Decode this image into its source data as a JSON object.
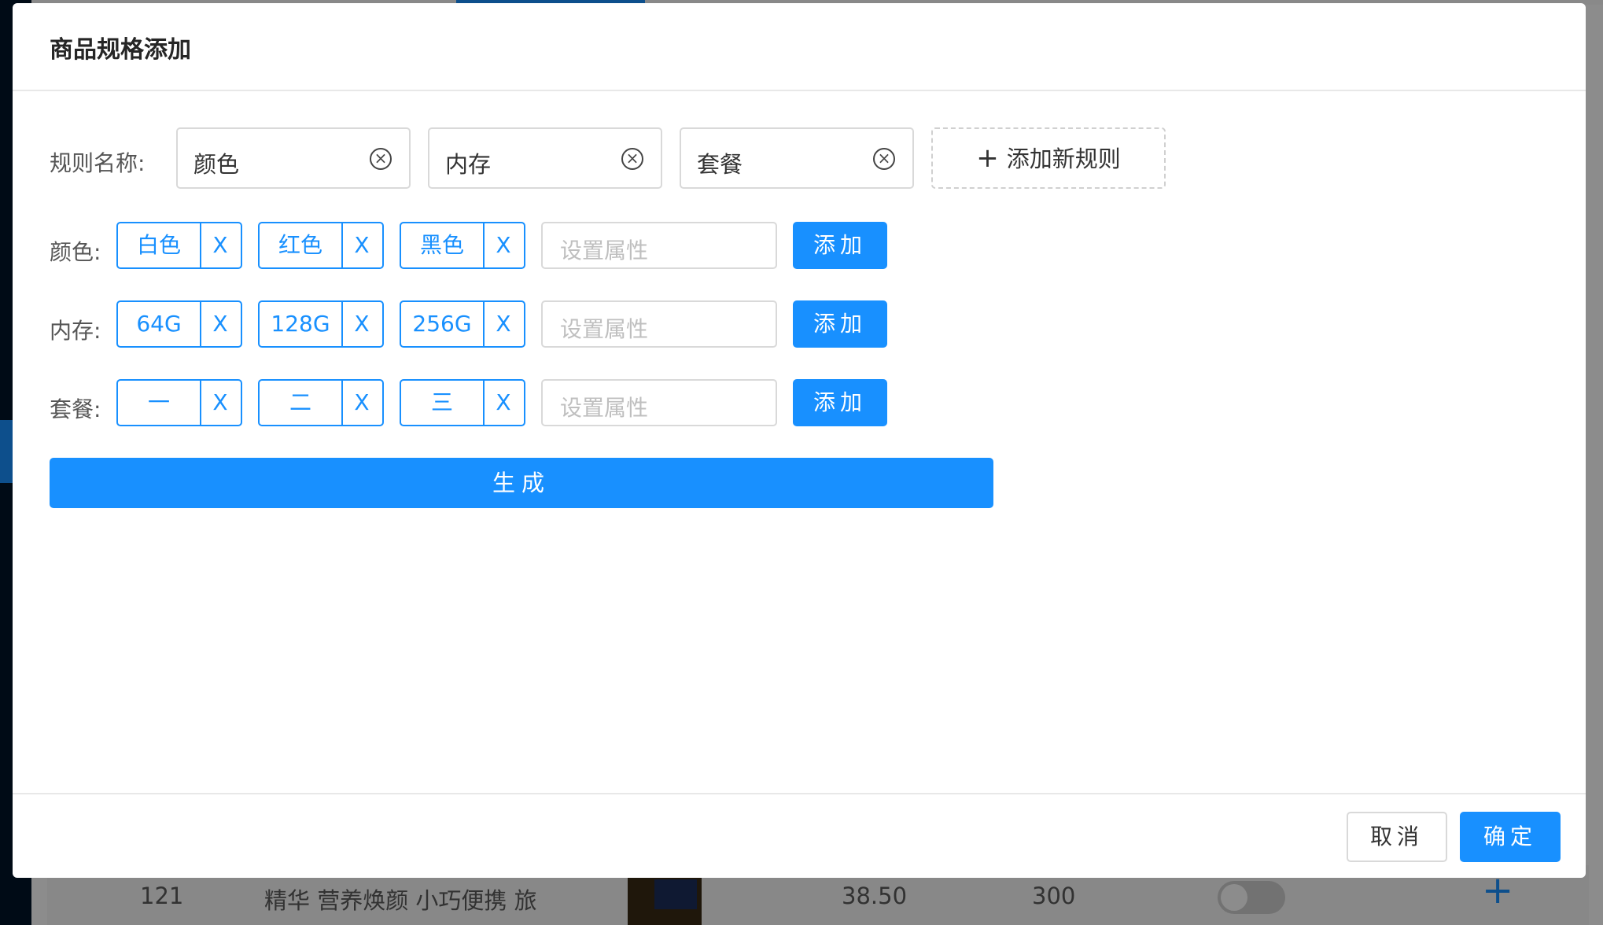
{
  "background_table": {
    "row": {
      "id": "121",
      "name": "精华 营养焕颜 小巧便携 旅",
      "price": "38.50",
      "stock": "300"
    }
  },
  "modal": {
    "title": "商品规格添加",
    "rule_label": "规则名称:",
    "rule_names": [
      "颜色",
      "内存",
      "套餐"
    ],
    "add_rule_label": "添加新规则",
    "groups": [
      {
        "label": "颜色:",
        "values": [
          "白色",
          "红色",
          "黑色"
        ]
      },
      {
        "label": "内存:",
        "values": [
          "64G",
          "128G",
          "256G"
        ]
      },
      {
        "label": "套餐:",
        "values": [
          "一",
          "二",
          "三"
        ]
      }
    ],
    "remove_label": "X",
    "attr_placeholder": "设置属性",
    "add_button": "添加",
    "generate_button": "生成",
    "cancel_button": "取消",
    "ok_button": "确定"
  },
  "colors": {
    "primary": "#1890ff",
    "border": "#d9d9d9",
    "placeholder": "#bfbfbf"
  }
}
